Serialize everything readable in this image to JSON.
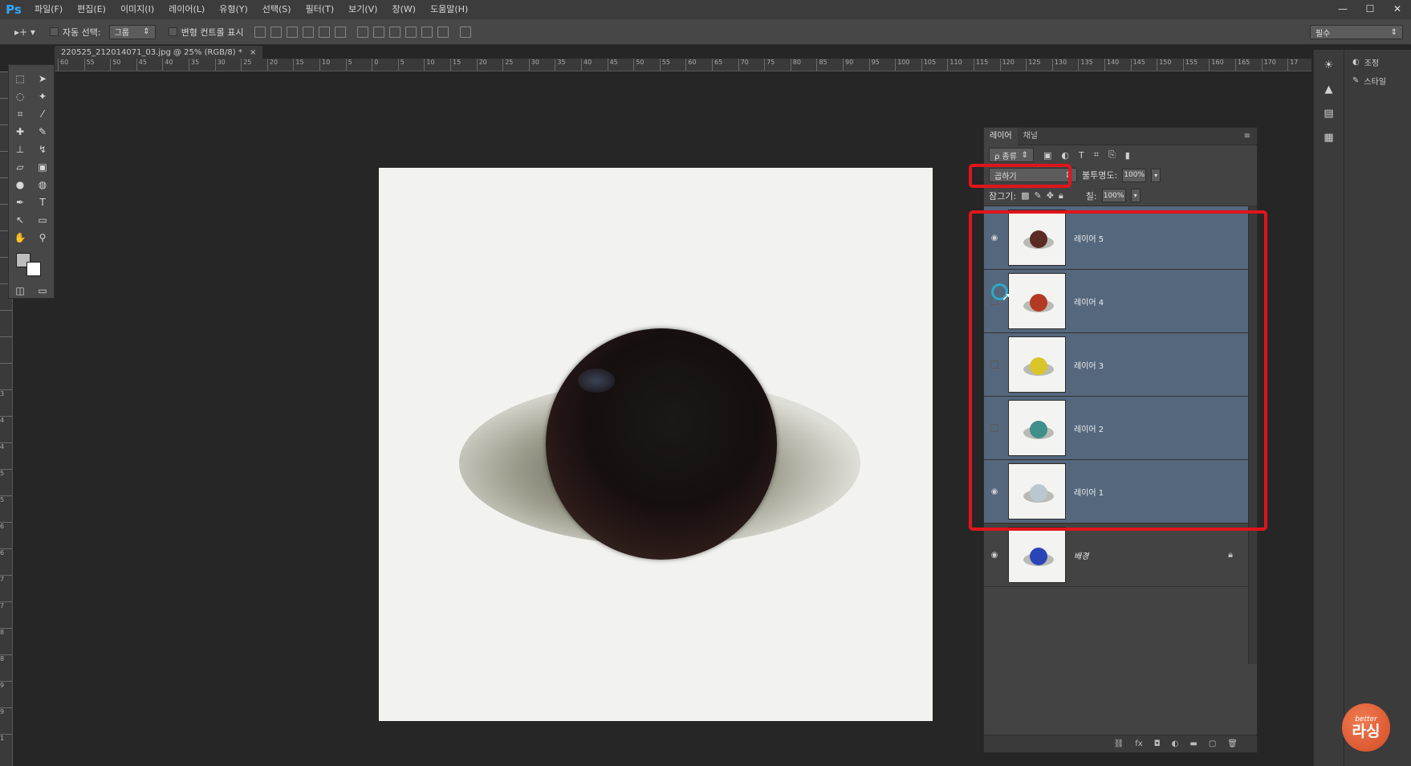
{
  "app": {
    "logo": "Ps"
  },
  "menu": [
    "파일(F)",
    "편집(E)",
    "이미지(I)",
    "레이어(L)",
    "유형(Y)",
    "선택(S)",
    "필터(T)",
    "보기(V)",
    "창(W)",
    "도움말(H)"
  ],
  "window_controls": [
    "—",
    "☐",
    "✕"
  ],
  "options_bar": {
    "auto_select_label": "자동 선택:",
    "auto_select_value": "그룹",
    "transform_label": "변형 컨트롤 표시",
    "workspace": "필수"
  },
  "document": {
    "tab_title": "220525_212014071_03.jpg @ 25% (RGB/8) *"
  },
  "rulers": {
    "horizontal": [
      "60",
      "55",
      "50",
      "45",
      "40",
      "35",
      "30",
      "25",
      "20",
      "15",
      "10",
      "5",
      "0",
      "5",
      "10",
      "15",
      "20",
      "25",
      "30",
      "35",
      "40",
      "45",
      "50",
      "55",
      "60",
      "65",
      "70",
      "75",
      "80",
      "85",
      "90",
      "95",
      "100",
      "105",
      "110",
      "115",
      "120",
      "125",
      "130",
      "135",
      "140",
      "145",
      "150",
      "155",
      "160",
      "165",
      "170",
      "17"
    ],
    "vertical": [
      "",
      "",
      "",
      "",
      "",
      "",
      "",
      "",
      "",
      "",
      "",
      "",
      "3",
      "4",
      "4",
      "5",
      "5",
      "6",
      "6",
      "7",
      "7",
      "8",
      "8",
      "9",
      "9",
      "1"
    ]
  },
  "right_dock": {
    "adjustments": "조정",
    "styles": "스타일"
  },
  "layers_panel": {
    "tabs": [
      "레이어",
      "채널"
    ],
    "filter_label": "ρ 종류",
    "blend_mode": "곱하기",
    "opacity_label": "불투명도:",
    "opacity": "100%",
    "lock_label": "잠그기:",
    "fill_label": "칠:",
    "fill": "100%",
    "layers": [
      {
        "name": "레이어 5",
        "visible": true,
        "selected": true,
        "ball_color": "#5a2b26"
      },
      {
        "name": "레이어 4",
        "visible": false,
        "selected": true,
        "ball_color": "#b33a22"
      },
      {
        "name": "레이어 3",
        "visible": false,
        "selected": true,
        "ball_color": "#d9c52a"
      },
      {
        "name": "레이어 2",
        "visible": false,
        "selected": true,
        "ball_color": "#3f8f8c"
      },
      {
        "name": "레이어 1",
        "visible": true,
        "selected": true,
        "ball_color": "#b9c7cf"
      },
      {
        "name": "배경",
        "visible": true,
        "selected": false,
        "ball_color": "#2a45b8",
        "locked": true
      }
    ]
  },
  "watermark": {
    "small": "better",
    "big": "라싱"
  },
  "colors": {
    "highlight": "#e0151c",
    "selected_layer": "#55677d",
    "ps_blue": "#31a8ff"
  }
}
